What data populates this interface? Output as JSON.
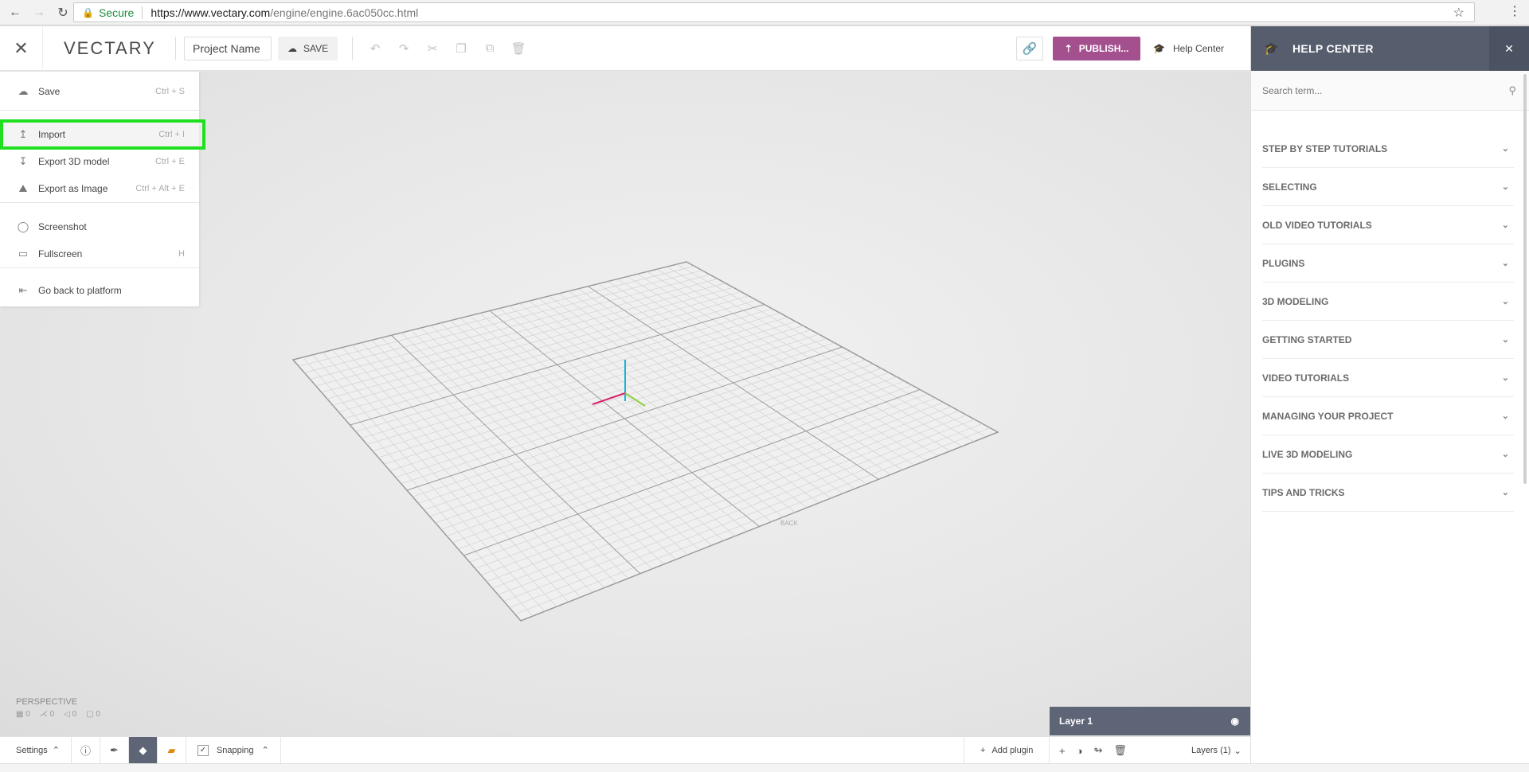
{
  "browser": {
    "secure_label": "Secure",
    "url_host": "https://www.vectary.com",
    "url_path": "/engine/engine.6ac050cc.html"
  },
  "header": {
    "brand": "VECTARY",
    "project_name": "Project Name",
    "save_label": "SAVE",
    "publish_label": "PUBLISH...",
    "help_label": "Help Center"
  },
  "file_menu": {
    "items": [
      {
        "label": "Save",
        "shortcut": "Ctrl + S",
        "icon": "cloud-upload-icon"
      },
      {
        "label": "Import",
        "shortcut": "Ctrl + I",
        "icon": "import-icon"
      },
      {
        "label": "Export 3D model",
        "shortcut": "Ctrl + E",
        "icon": "export-icon"
      },
      {
        "label": "Export as Image",
        "shortcut": "Ctrl + Alt + E",
        "icon": "image-icon"
      },
      {
        "label": "Screenshot",
        "shortcut": "",
        "icon": "camera-icon"
      },
      {
        "label": "Fullscreen",
        "shortcut": "H",
        "icon": "monitor-icon"
      },
      {
        "label": "Go back to platform",
        "shortcut": "",
        "icon": "exit-icon"
      }
    ]
  },
  "viewport": {
    "perspective_label": "PERSPECTIVE",
    "stats": [
      "0",
      "0",
      "0",
      "0"
    ],
    "axis_label": "BACK"
  },
  "help_center": {
    "title": "HELP CENTER",
    "search_placeholder": "Search term...",
    "sections": [
      "STEP BY STEP TUTORIALS",
      "SELECTING",
      "OLD VIDEO TUTORIALS",
      "PLUGINS",
      "3D MODELING",
      "GETTING STARTED",
      "VIDEO TUTORIALS",
      "MANAGING YOUR PROJECT",
      "LIVE 3D MODELING",
      "TIPS AND TRICKS"
    ]
  },
  "layer_panel": {
    "name": "Layer 1"
  },
  "bottom_bar": {
    "settings_label": "Settings",
    "snapping_label": "Snapping",
    "add_plugin_label": "Add plugin",
    "layers_label": "Layers (1)"
  },
  "colors": {
    "publish": "#a4508f",
    "help_header": "#565d6c",
    "highlight": "#1fe01f",
    "axis_x": "#d6206a",
    "axis_y": "#1ab3d6",
    "axis_z": "#8ccf3a"
  }
}
